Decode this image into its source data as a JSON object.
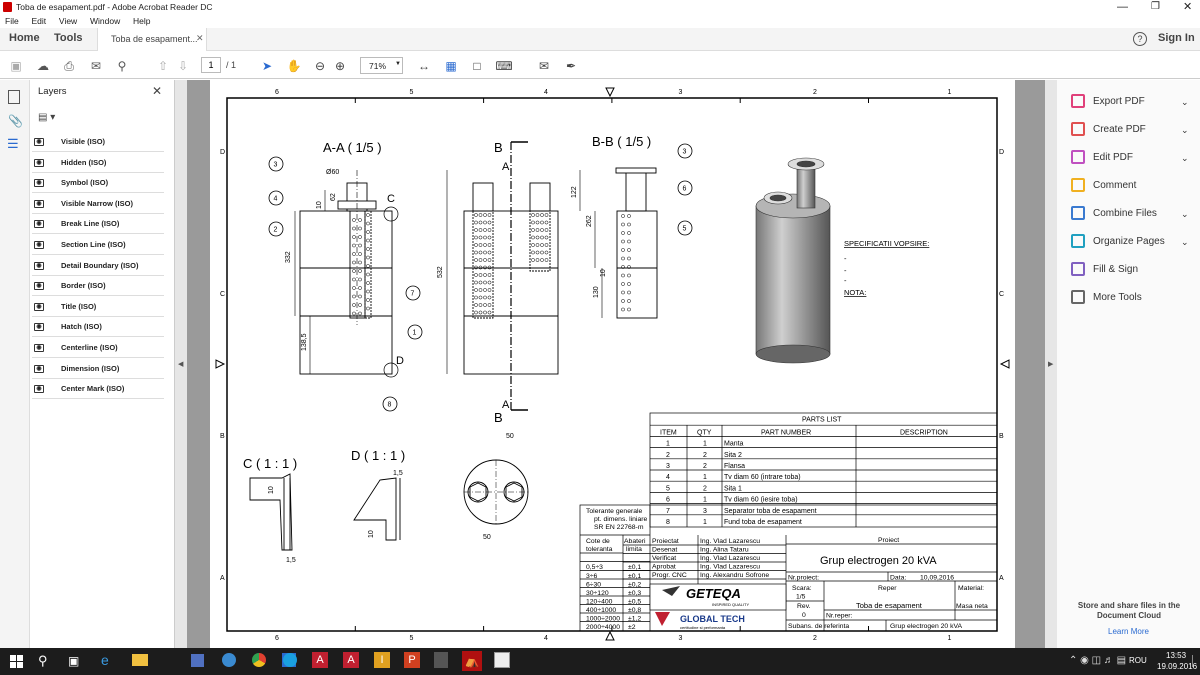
{
  "window": {
    "title": "Toba de esapament.pdf - Adobe Acrobat Reader DC",
    "controls": [
      "minimize",
      "maximize",
      "close"
    ]
  },
  "menu": [
    "File",
    "Edit",
    "View",
    "Window",
    "Help"
  ],
  "nav": {
    "home": "Home",
    "tools": "Tools",
    "doc_tab": "Toba de esapament...",
    "help_icon": "?",
    "signin": "Sign In"
  },
  "toolbar": {
    "page_current": "1",
    "page_total": "/ 1",
    "zoom": "71%"
  },
  "layers_panel": {
    "title": "Layers",
    "items": [
      "Visible (ISO)",
      "Hidden (ISO)",
      "Symbol (ISO)",
      "Visible Narrow (ISO)",
      "Break Line (ISO)",
      "Section Line (ISO)",
      "Detail Boundary (ISO)",
      "Border (ISO)",
      "Title (ISO)",
      "Hatch (ISO)",
      "Centerline (ISO)",
      "Dimension (ISO)",
      "Center Mark (ISO)"
    ]
  },
  "right_panel": {
    "items": [
      {
        "label": "Export PDF",
        "color": "#e0407a",
        "chevron": true
      },
      {
        "label": "Create PDF",
        "color": "#e05050",
        "chevron": true
      },
      {
        "label": "Edit PDF",
        "color": "#c050c0",
        "chevron": true
      },
      {
        "label": "Comment",
        "color": "#f0b020",
        "chevron": false
      },
      {
        "label": "Combine Files",
        "color": "#3a7ad0",
        "chevron": true
      },
      {
        "label": "Organize Pages",
        "color": "#20a0c0",
        "chevron": true
      },
      {
        "label": "Fill & Sign",
        "color": "#8060c0",
        "chevron": false
      },
      {
        "label": "More Tools",
        "color": "#666666",
        "chevron": false
      }
    ],
    "cloud_text": "Store and share files in the Document Cloud",
    "learn_more": "Learn More"
  },
  "drawing": {
    "border_top_nums": [
      "6",
      "5",
      "4",
      "3",
      "2",
      "1"
    ],
    "border_side_letters": [
      "D",
      "C",
      "B",
      "A"
    ],
    "view_aa": "A-A ( 1/5 )",
    "view_bb": "B-B ( 1/5 )",
    "view_c": "C ( 1 : 1 )",
    "view_d": "D ( 1 : 1 )",
    "label_b": "B",
    "label_a": "A",
    "label_c": "C",
    "label_d": "D",
    "dims": {
      "d60": "Ø60",
      "d62": "62",
      "d10": "10",
      "d332": "332",
      "d1385": "138,5",
      "d532": "532",
      "d122": "122",
      "d262": "262",
      "d130": "130",
      "d50": "50",
      "d15": "1,5"
    },
    "balloons": [
      "1",
      "2",
      "3",
      "4",
      "5",
      "6",
      "7",
      "8"
    ],
    "spec_title": "SPECIFICATII VOPSIRE:",
    "spec_lines": [
      "-",
      "-",
      "-"
    ],
    "nota": "NOTA:"
  },
  "parts_list": {
    "title": "PARTS LIST",
    "headers": [
      "ITEM",
      "QTY",
      "PART NUMBER",
      "DESCRIPTION"
    ],
    "rows": [
      [
        "1",
        "1",
        "Manta",
        ""
      ],
      [
        "2",
        "2",
        "Sita 2",
        ""
      ],
      [
        "3",
        "2",
        "Flansa",
        ""
      ],
      [
        "4",
        "1",
        "Tv diam 60 (intrare toba)",
        ""
      ],
      [
        "5",
        "2",
        "Sita 1",
        ""
      ],
      [
        "6",
        "1",
        "Tv diam 60 (iesire toba)",
        ""
      ],
      [
        "7",
        "3",
        "Separator toba de esapament",
        ""
      ],
      [
        "8",
        "1",
        "Fund toba de esapament",
        ""
      ]
    ]
  },
  "title_block": {
    "tol_title": [
      "Tolerante generale",
      "pt. dimens. liniare",
      "SR EN 22768-m"
    ],
    "tol_header1": [
      "Cote de",
      "toleranta"
    ],
    "tol_header2": [
      "Abateri",
      "limita"
    ],
    "tol_rows": [
      [
        "0,5÷3",
        "±0,1"
      ],
      [
        "3÷6",
        "±0,1"
      ],
      [
        "6÷30",
        "±0,2"
      ],
      [
        "30÷120",
        "±0,3"
      ],
      [
        "120÷400",
        "±0,5"
      ],
      [
        "400÷1000",
        "±0,8"
      ],
      [
        "1000÷2000",
        "±1,2"
      ],
      [
        "2000÷4000",
        "±2"
      ]
    ],
    "roles": [
      [
        "Proiectat",
        "Ing. Vlad Lazarescu"
      ],
      [
        "Desenat",
        "Ing. Alina Tataru"
      ],
      [
        "Verificat",
        "Ing. Vlad Lazarescu"
      ],
      [
        "Aprobat",
        "Ing. Vlad Lazarescu"
      ],
      [
        "Progr. CNC",
        "Ing. Alexandru Sofrone"
      ]
    ],
    "proiect_label": "Proiect",
    "proiect_name": "Grup electrogen 20 kVA",
    "nr_proiect": "Nr.proiect:",
    "data": "Data:",
    "data_val": "10,09,2016",
    "scara": "Scara:",
    "scara_val": "1/5",
    "rev": "Rev.",
    "rev_val": "0",
    "reper_label": "Reper",
    "reper_name": "Toba de esapament",
    "material_label": "Material:",
    "material_val": "Masa neta",
    "nr_reper": "Nr.reper:",
    "subans": "Subans. de referinta",
    "subans_val": "Grup electrogen 20 kVA",
    "logo1": "GETEQA",
    "logo1_sub": "INSPIRED QUALITY",
    "logo2": "GLOBAL TECH",
    "logo2_sub": "certitudine si performanta"
  },
  "taskbar": {
    "lang": "ROU",
    "time": "13:53",
    "date": "19.09.2016"
  }
}
